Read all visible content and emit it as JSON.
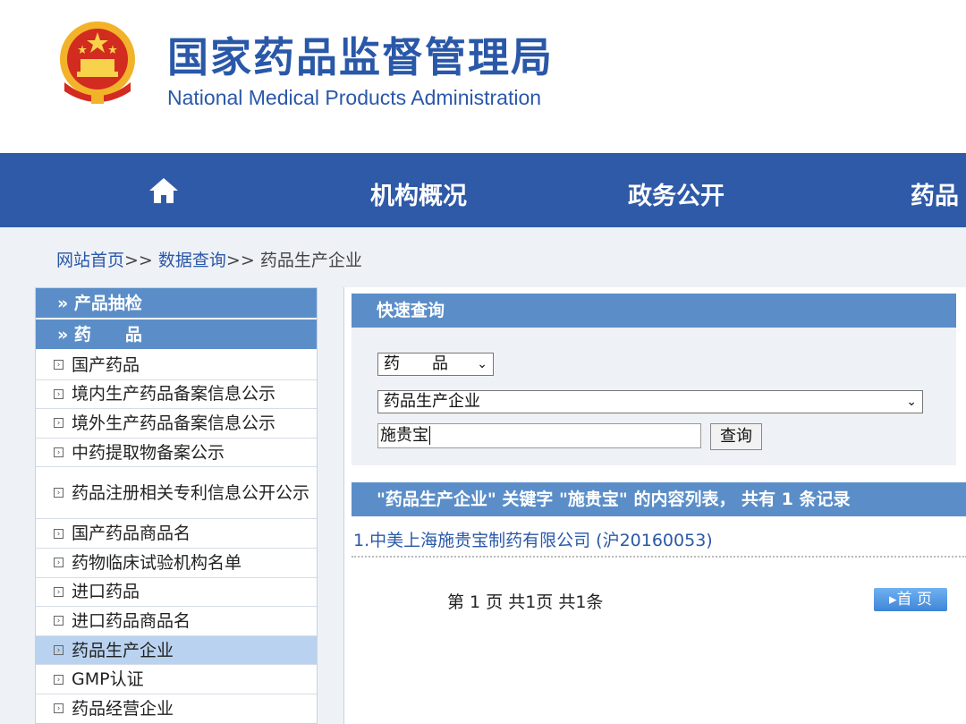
{
  "header": {
    "title_cn": "国家药品监督管理局",
    "title_en": "National Medical Products Administration"
  },
  "nav": {
    "items": [
      "机构概况",
      "政务公开",
      "药品"
    ]
  },
  "breadcrumb": {
    "home": "网站首页",
    "sep": ">>",
    "data_query": "数据查询",
    "current": "药品生产企业"
  },
  "sidebar": {
    "headers": [
      "» 产品抽检",
      "» 药　　品"
    ],
    "items": [
      {
        "label": "国产药品"
      },
      {
        "label": "境内生产药品备案信息公示"
      },
      {
        "label": "境外生产药品备案信息公示"
      },
      {
        "label": "中药提取物备案公示"
      },
      {
        "label": "药品注册相关专利信息公开公示"
      },
      {
        "label": "国产药品商品名"
      },
      {
        "label": "药物临床试验机构名单"
      },
      {
        "label": "进口药品"
      },
      {
        "label": "进口药品商品名"
      },
      {
        "label": "药品生产企业",
        "active": true
      },
      {
        "label": "GMP认证"
      },
      {
        "label": "药品经营企业"
      }
    ]
  },
  "quick_search": {
    "title": "快速查询",
    "category_value": "药　　品",
    "subcategory_value": "药品生产企业",
    "keyword_value": "施贵宝",
    "submit_label": "查询"
  },
  "results": {
    "header": "\"药品生产企业\" 关键字 \"施贵宝\" 的内容列表， 共有 1 条记录",
    "items": [
      "1.中美上海施贵宝制药有限公司 (沪20160053)"
    ],
    "pager_text": "第 1 页 共1页 共1条",
    "first_page_label": "首 页"
  }
}
